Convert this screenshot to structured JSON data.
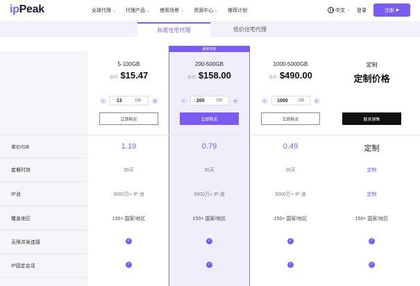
{
  "nav": {
    "logo_ip": "ip",
    "logo_name": "Peak",
    "menu": [
      "全球代理",
      "代理产品",
      "使用场景",
      "资源中心",
      "推荐计划"
    ],
    "lang": "中文",
    "login": "登录",
    "register": "注册"
  },
  "tabs": [
    {
      "label": "标准住宅代理",
      "active": true
    },
    {
      "label": "低价住宅代理",
      "active": false
    }
  ],
  "popular_badge": "最受欢迎",
  "plans": [
    {
      "range": "5-100GB",
      "price_label": "总价:",
      "price": "$15.47",
      "qty": "13",
      "unit": "GB",
      "button": "立即购买",
      "style": "outline"
    },
    {
      "range": "200-500GB",
      "price_label": "总价:",
      "price": "$158.00",
      "qty": "200",
      "unit": "GB",
      "button": "立即购买",
      "style": "fill"
    },
    {
      "range": "1000-5000GB",
      "price_label": "总价:",
      "price": "$490.00",
      "qty": "1000",
      "unit": "GB",
      "button": "立即购买",
      "style": "outline"
    },
    {
      "range": "定制",
      "price_label": "",
      "price": "定制价格",
      "qty": "",
      "unit": "",
      "button": "联系销售",
      "style": "dark"
    }
  ],
  "rows": [
    {
      "label": "单价/GB",
      "values": [
        "1.19",
        "0.79",
        "0.49",
        "定制"
      ],
      "kind": "big"
    },
    {
      "label": "套餐时效",
      "values": [
        "30天",
        "30天",
        "30天",
        "定制"
      ],
      "kind": "text"
    },
    {
      "label": "IP池",
      "values": [
        "9000万+ IP 池",
        "9000万+ IP 池",
        "9000万+ IP 池",
        "定制"
      ],
      "kind": "text"
    },
    {
      "label": "覆盖地区",
      "values": [
        "150+ 国家/地区",
        "150+ 国家/地区",
        "150+ 国家/地区",
        "150+ 国家/地区"
      ],
      "kind": "text"
    },
    {
      "label": "无限并发连接",
      "values": [
        "✓",
        "✓",
        "✓",
        "✓"
      ],
      "kind": "check"
    },
    {
      "label": "IP固定会话",
      "values": [
        "✓",
        "✓",
        "✓",
        "✓"
      ],
      "kind": "check"
    }
  ],
  "colors": {
    "accent": "#7b5cf0",
    "highlight_bg": "#f1eefc"
  }
}
